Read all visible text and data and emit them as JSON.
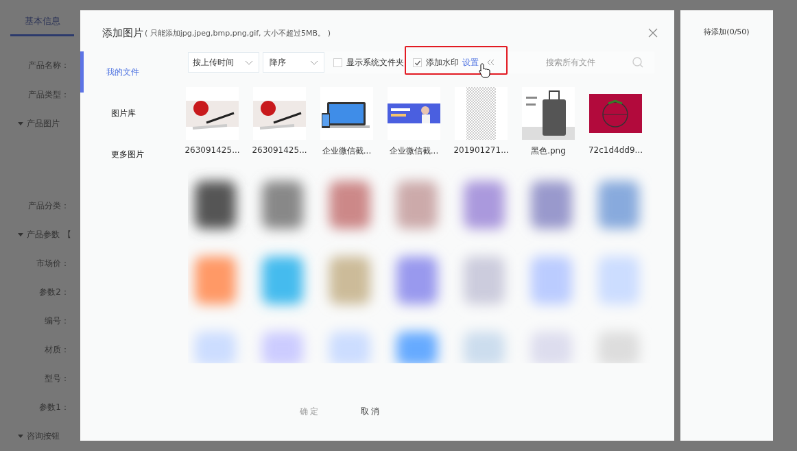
{
  "background_form": {
    "tab": {
      "label": "基本信息",
      "selected": true
    },
    "rows": [
      {
        "kind": "field",
        "label": "产品名称："
      },
      {
        "kind": "field",
        "label": "产品类型："
      },
      {
        "kind": "section",
        "label": "产品图片"
      },
      {
        "kind": "field",
        "label": "产品分类："
      },
      {
        "kind": "section",
        "label": "产品参数",
        "suffix": "【"
      },
      {
        "kind": "field",
        "label": "市场价："
      },
      {
        "kind": "field",
        "label": "参数2："
      },
      {
        "kind": "field",
        "label": "编号："
      },
      {
        "kind": "field",
        "label": "材质："
      },
      {
        "kind": "field",
        "label": "型号："
      },
      {
        "kind": "field",
        "label": "参数1："
      },
      {
        "kind": "section",
        "label": "咨询按钮"
      }
    ]
  },
  "dialog": {
    "title": "添加图片",
    "hint": "( 只能添加jpg,jpeg,bmp,png,gif, 大小不超过5MB。 )",
    "nav": [
      {
        "label": "我的文件",
        "selected": true
      },
      {
        "label": "图片库",
        "selected": false
      },
      {
        "label": "更多图片",
        "selected": false
      }
    ],
    "sort_by": {
      "value": "按上传时间"
    },
    "order": {
      "value": "降序"
    },
    "options": [
      {
        "label": "显示系统文件夹",
        "checked": false
      },
      {
        "label": "添加水印",
        "checked": true,
        "link": "设置"
      }
    ],
    "search": {
      "placeholder": "搜索所有文件"
    },
    "files": [
      {
        "name": "263091425...",
        "kind": "photo"
      },
      {
        "name": "263091425...",
        "kind": "photo"
      },
      {
        "name": "企业微信截...",
        "kind": "laptop"
      },
      {
        "name": "企业微信截...",
        "kind": "banner"
      },
      {
        "name": "201901271...",
        "kind": "pattern"
      },
      {
        "name": "黑色.png",
        "kind": "suitcase"
      },
      {
        "name": "72c1d4dd9...",
        "kind": "tomato"
      }
    ],
    "buttons": [
      {
        "label": "确 定",
        "disabled": true
      },
      {
        "label": "取 消",
        "disabled": false
      }
    ]
  },
  "pending_panel": {
    "title": "待添加(0/50)"
  }
}
